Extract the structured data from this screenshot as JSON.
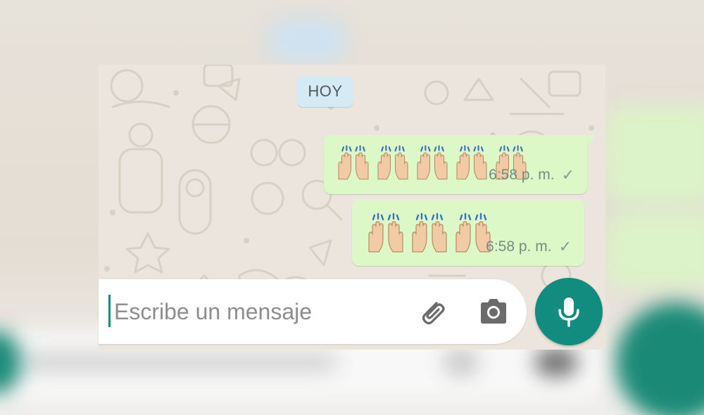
{
  "chat": {
    "date_chip": "HOY",
    "messages": [
      {
        "emoji_name": "raising-hands-emoji",
        "emoji_count": 5,
        "time": "6:58 p. m.",
        "status": "✓"
      },
      {
        "emoji_name": "raising-hands-emoji",
        "emoji_count": 3,
        "time": "6:58 p. m.",
        "status": "✓"
      }
    ]
  },
  "composer": {
    "placeholder": "Escribe un mensaje",
    "attach_icon": "paperclip-icon",
    "camera_icon": "camera-icon",
    "send_icon": "microphone-icon"
  },
  "colors": {
    "outgoing_bubble": "#dcf8c6",
    "date_chip": "#d4eaf4",
    "accent": "#128c7e",
    "wallpaper": "#ece5dd"
  }
}
